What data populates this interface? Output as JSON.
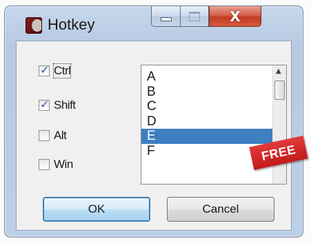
{
  "window": {
    "title": "Hotkey",
    "close_glyph": "X"
  },
  "modifiers": [
    {
      "label": "Ctrl",
      "checked": true
    },
    {
      "label": "Shift",
      "checked": true
    },
    {
      "label": "Alt",
      "checked": false
    },
    {
      "label": "Win",
      "checked": false
    }
  ],
  "keys": {
    "items": [
      "A",
      "B",
      "C",
      "D",
      "E",
      "F"
    ],
    "selected": "E"
  },
  "badge": {
    "text": "FREE"
  },
  "buttons": {
    "ok": "OK",
    "cancel": "Cancel"
  },
  "icons": {
    "check": "✓",
    "scroll_up": "▲"
  }
}
